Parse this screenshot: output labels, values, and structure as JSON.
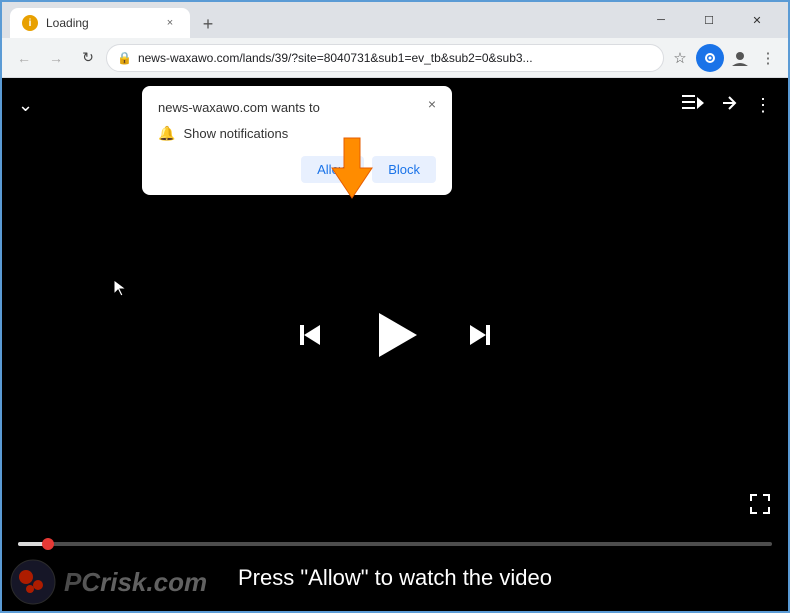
{
  "browser": {
    "tab": {
      "title": "Loading",
      "favicon_label": "i"
    },
    "new_tab_btn": "+",
    "address": "news-waxawo.com/lands/39/?site=8040731&sub1=ev_tb&sub2=0&sub3...",
    "extensions_icon": "⬤",
    "window_controls": {
      "minimize": "─",
      "maximize": "☐",
      "close": "✕"
    },
    "nav": {
      "back": "←",
      "forward": "→",
      "reload": "↻"
    }
  },
  "notification_popup": {
    "title": "news-waxawo.com wants to",
    "notification_row_text": "Show notifications",
    "allow_btn": "Allow",
    "block_btn": "Block",
    "close_btn": "×"
  },
  "player": {
    "cta_text": "Press \"Allow\" to watch the video",
    "chevron_down": "⌄",
    "playlist_icon": "≡▶",
    "share_icon": "↗",
    "more_icon": "⋮",
    "skip_prev": "⏮",
    "skip_next": "⏭",
    "fullscreen": "⛶"
  },
  "watermark": {
    "text_plain": "risk.com",
    "text_colored": "PC"
  }
}
